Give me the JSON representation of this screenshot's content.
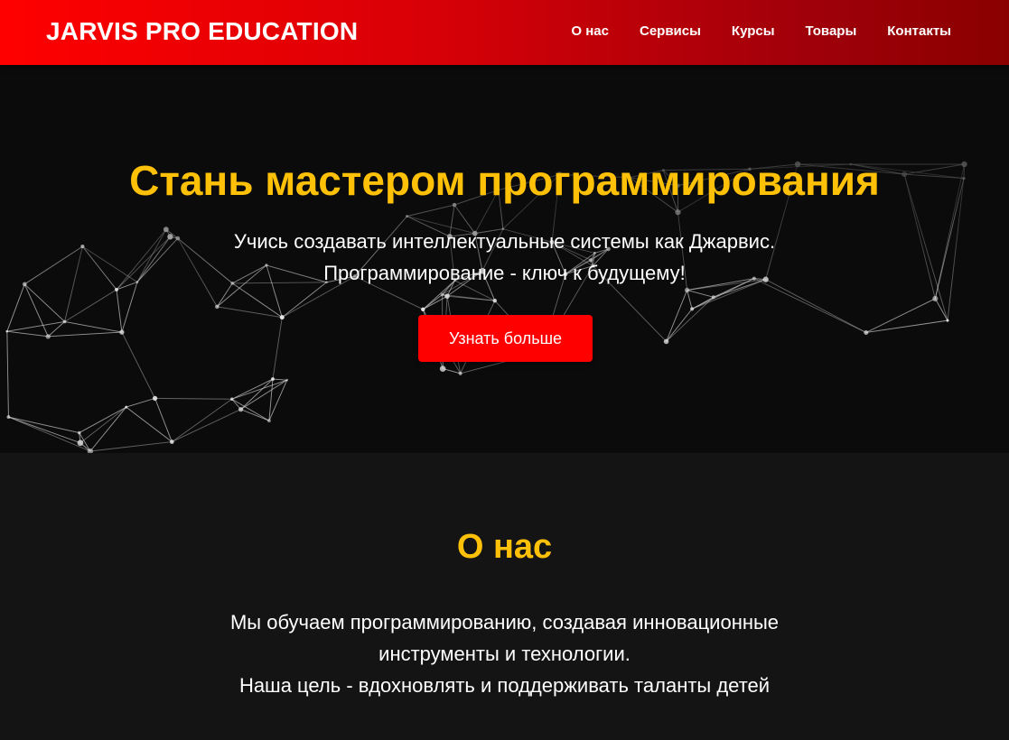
{
  "header": {
    "logo": "JARVIS PRO EDUCATION",
    "nav": [
      {
        "label": "О нас"
      },
      {
        "label": "Сервисы"
      },
      {
        "label": "Курсы"
      },
      {
        "label": "Товары"
      },
      {
        "label": "Контакты"
      }
    ]
  },
  "hero": {
    "title": "Стань мастером программирования",
    "subtitle_lines": [
      "Учись создавать интеллектуальные системы как Джарвис.",
      "Программирование - ключ к будущему!"
    ],
    "button_label": "Узнать больше",
    "background_image": "network-lines-image"
  },
  "about": {
    "title": "О нас",
    "text_lines": [
      "Мы обучаем программированию, создавая инновационные",
      "инструменты и технологии.",
      "Наша цель - вдохновлять и поддерживать таланты детей"
    ]
  },
  "colors": {
    "header_gradient_start": "#ff0000",
    "header_gradient_end": "#8a0000",
    "accent_yellow": "#ffc107",
    "button_red": "#ff0000",
    "background": "#141414",
    "text": "#ffffff"
  }
}
